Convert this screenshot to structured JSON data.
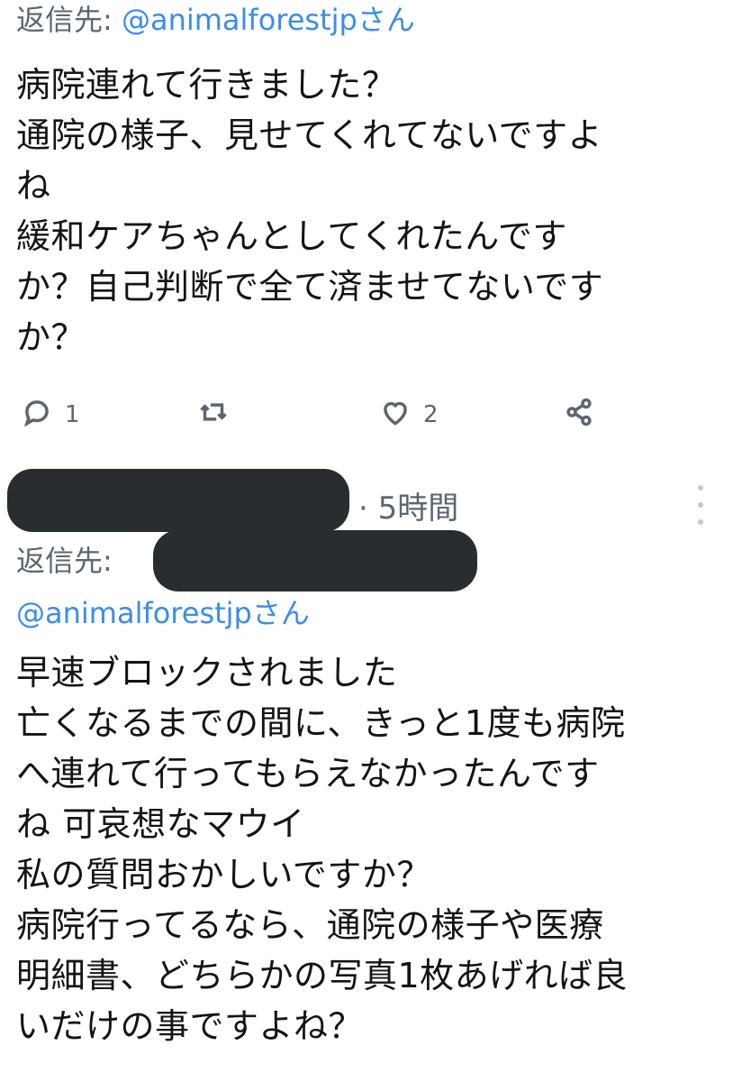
{
  "tweet1": {
    "reply_prefix": "返信先: ",
    "reply_handle": "@animalforestjpさん",
    "lines": [
      "病院連れて行きました？",
      "通院の様子、見せてくれてないですよ",
      "ね",
      "緩和ケアちゃんとしてくれたんです",
      "か？自己判断で全て済ませてないです",
      "か？"
    ],
    "reply_count": "1",
    "like_count": "2"
  },
  "tweet2": {
    "time": "· 5時間",
    "reply_prefix": "返信先: ",
    "reply_handle": "@animalforestjpさん",
    "lines": [
      "早速ブロックされました",
      "亡くなるまでの間に、きっと1度も病院",
      "へ連れて行ってもらえなかったんです",
      "ね 可哀想なマウイ",
      "私の質問おかしいですか？",
      "病院行ってるなら、通院の様子や医療",
      "明細書、どちらかの写真1枚あげれば良",
      "いだけの事ですよね？"
    ]
  },
  "icons": {
    "reply": "reply-icon",
    "retweet": "retweet-icon",
    "like": "heart-icon",
    "share": "share-icon",
    "more": "more-vertical-icon"
  },
  "colors": {
    "link": "#3a8ee6",
    "muted": "#5b6670",
    "redaction": "#2a2d30"
  }
}
